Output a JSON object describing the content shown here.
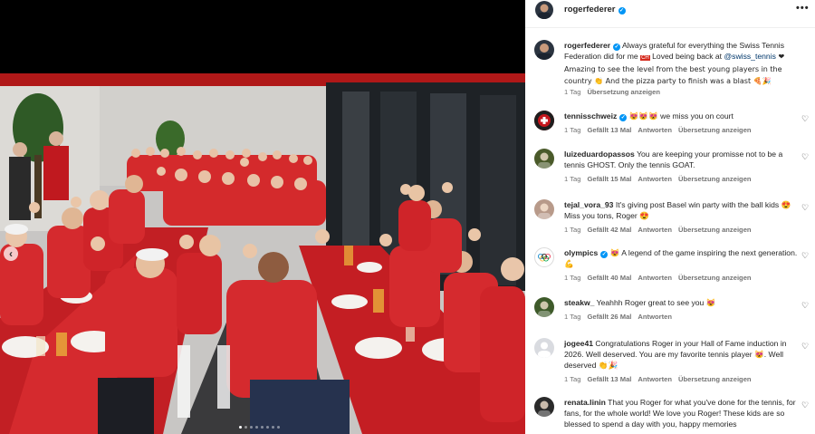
{
  "post": {
    "username": "rogerfederer",
    "more_icon": "•••",
    "carousel_prev_icon": "‹",
    "carousel_dots": 8,
    "carousel_active_dot": 0,
    "caption": {
      "username": "rogerfederer",
      "text_before_mention": "Always grateful for everything the Swiss Tennis Federation did for me ",
      "flag": "CH",
      "text_mid": " Loved being back at ",
      "mention": "@swiss_tennis",
      "text_after_mention": " ❤ Amazing to see the level from the best young players in the country 👏 And the pizza party to finish was a blast 🍕🎉",
      "time": "1 Tag",
      "translate": "Übersetzung anzeigen"
    }
  },
  "comments": [
    {
      "username": "tennisschweiz",
      "verified": true,
      "text": "😻😻😻 we miss you on court",
      "time": "1 Tag",
      "likes": "Gefällt 13 Mal",
      "reply": "Antworten",
      "translate": "Übersetzung anzeigen",
      "avatar_color": "#c4161c"
    },
    {
      "username": "luizeduardopassos",
      "verified": false,
      "text": "You are keeping your promisse not to be a tennis GHOST. Only the tennis GOAT.",
      "time": "1 Tag",
      "likes": "Gefällt 15 Mal",
      "reply": "Antworten",
      "translate": "Übersetzung anzeigen",
      "avatar_color": "#4a5a2a"
    },
    {
      "username": "tejal_vora_93",
      "verified": false,
      "text": "It's giving post Basel win party with the ball kids 😍 Miss you tons, Roger 😍",
      "time": "1 Tag",
      "likes": "Gefällt 42 Mal",
      "reply": "Antworten",
      "translate": "Übersetzung anzeigen",
      "avatar_color": "#b89a8a"
    },
    {
      "username": "olympics",
      "verified": true,
      "text": "😻 A legend of the game inspiring the next generation. 💪",
      "time": "1 Tag",
      "likes": "Gefällt 40 Mal",
      "reply": "Antworten",
      "translate": "Übersetzung anzeigen",
      "avatar_color": "#ffffff"
    },
    {
      "username": "steakw_",
      "verified": false,
      "text": "Yeahhh Roger great to see you 😻",
      "time": "1 Tag",
      "likes": "Gefällt 26 Mal",
      "reply": "Antworten",
      "translate": "",
      "avatar_color": "#3e5a2a"
    },
    {
      "username": "jogee41",
      "verified": false,
      "text": "Congratulations Roger in your Hall of Fame induction in 2026. Well deserved. You are my favorite tennis player 😻. Well deserved 👏🎉",
      "time": "1 Tag",
      "likes": "Gefällt 13 Mal",
      "reply": "Antworten",
      "translate": "Übersetzung anzeigen",
      "avatar_color": "#d9dbe0"
    },
    {
      "username": "renata.linin",
      "verified": false,
      "text": "That you Roger for what you've done for the tennis, for fans, for the whole world! We love you Roger! These kids are so blessed to spend a day with you, happy memories",
      "time": "",
      "likes": "",
      "reply": "",
      "translate": "",
      "avatar_color": "#2a2a2a"
    }
  ],
  "icons": {
    "verified": "verified-badge-icon",
    "heart": "heart-icon"
  },
  "colors": {
    "verified_blue": "#0095f6",
    "mention": "#00376b",
    "muted": "#737373",
    "shirt_red": "#d9262a"
  }
}
